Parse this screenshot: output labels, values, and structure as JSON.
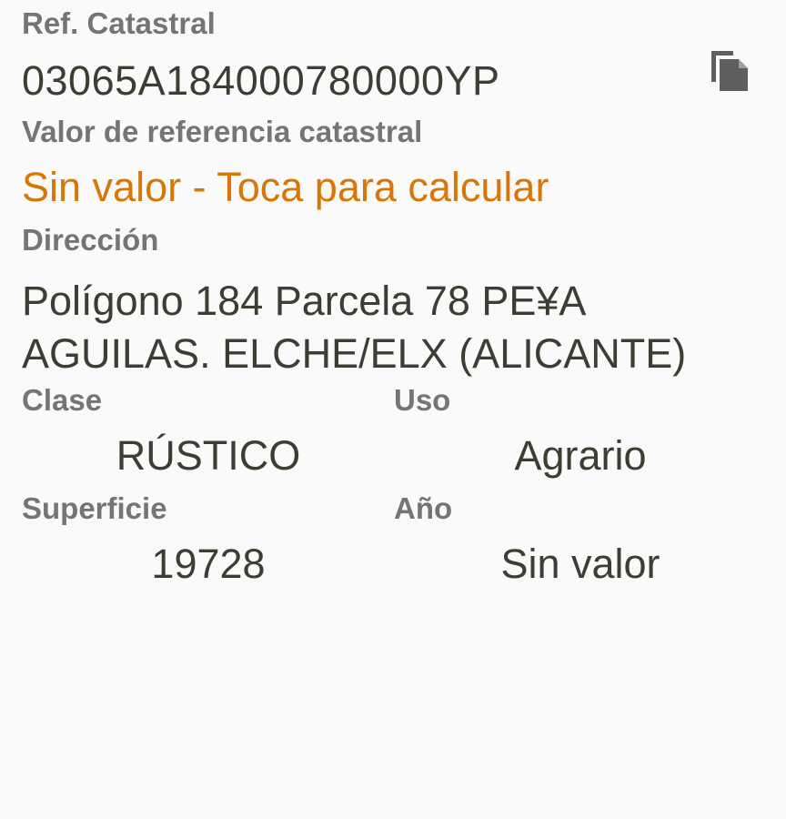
{
  "ref": {
    "label": "Ref. Catastral",
    "value": "03065A184000780000YP",
    "copy_icon": "copy-icon"
  },
  "valor": {
    "label": "Valor de referencia catastral",
    "value": "Sin valor - Toca para calcular"
  },
  "direccion": {
    "label": "Dirección",
    "value": "Polígono 184 Parcela 78 PE¥A AGUILAS. ELCHE/ELX (ALICANTE)"
  },
  "clase": {
    "label": "Clase",
    "value": "RÚSTICO"
  },
  "uso": {
    "label": "Uso",
    "value": "Agrario"
  },
  "superficie": {
    "label": "Superficie",
    "value": "19728"
  },
  "ano": {
    "label": "Año",
    "value": "Sin valor"
  },
  "colors": {
    "background": "#fafafa",
    "label": "#757575",
    "value": "#3d3d33",
    "accent": "#d97706",
    "icon": "#5f5f5f"
  }
}
